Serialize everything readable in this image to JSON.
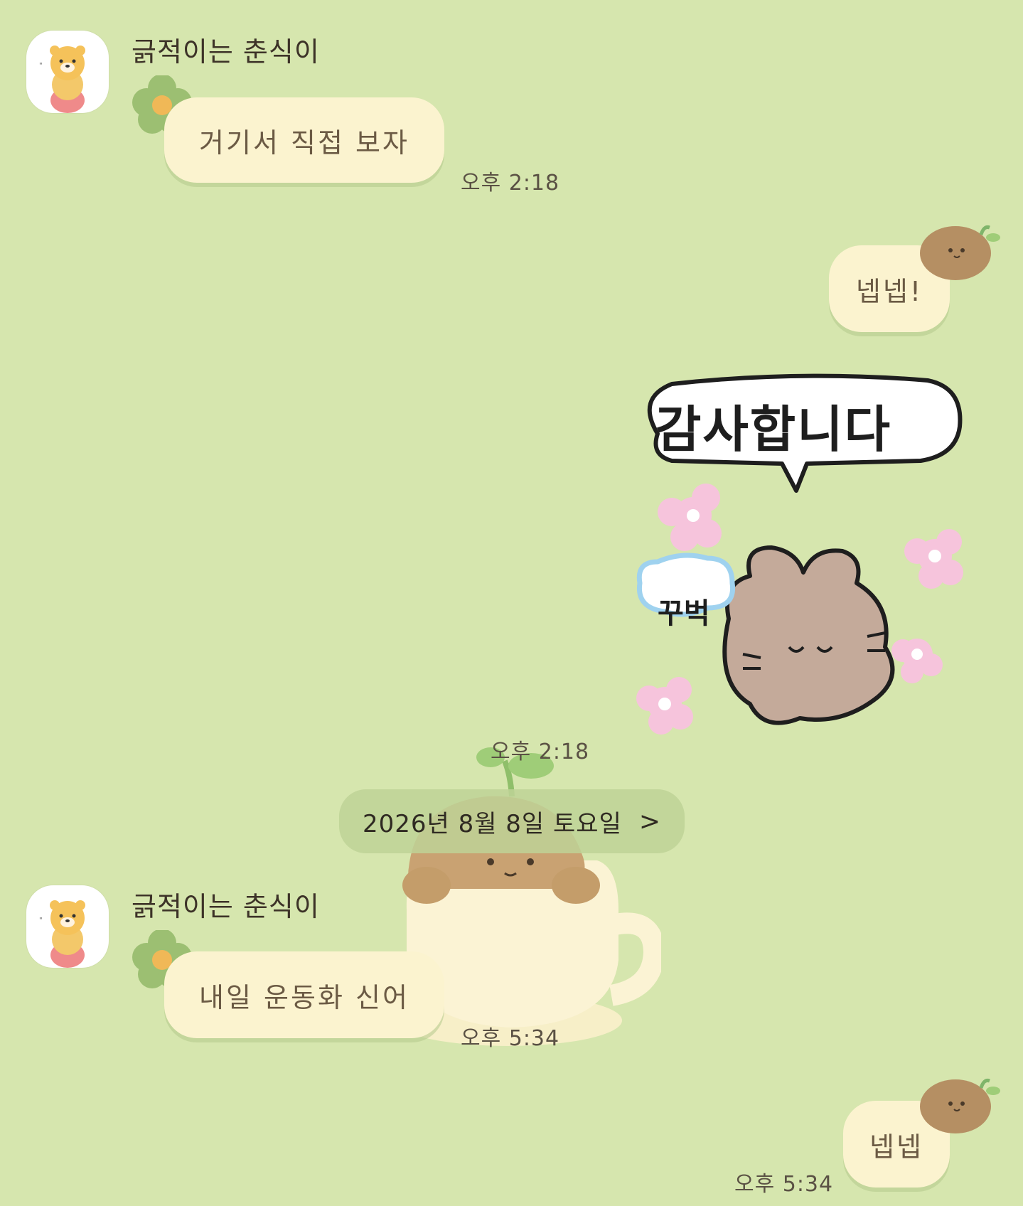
{
  "messages": [
    {
      "sender": "긁적이는 춘식이",
      "text": "거기서 직접 보자",
      "time": "오후 2:18",
      "side": "left"
    },
    {
      "text": "넵넵!",
      "side": "right"
    },
    {
      "sticker_text_main": "감사합니다",
      "sticker_text_side": "꾸벅",
      "time": "오후 2:18",
      "side": "right"
    },
    {
      "sender": "긁적이는 춘식이",
      "text": "내일 운동화 신어",
      "time": "오후 5:34",
      "side": "left"
    },
    {
      "text": "넵넵",
      "time": "오후 5:34",
      "side": "right"
    }
  ],
  "date_divider": {
    "label": "2026년 8월 8일 토요일",
    "chevron": ">"
  },
  "icons": {
    "avatar": "chunsik-avatar-icon",
    "flower": "green-flower-icon",
    "chestnut": "chestnut-decoration-icon",
    "sticker": "bunny-bow-sticker",
    "cup": "chestnut-cup-background"
  },
  "colors": {
    "background": "#d6e6ae",
    "bubble": "#fbf3cf",
    "text": "#6b5a44"
  }
}
